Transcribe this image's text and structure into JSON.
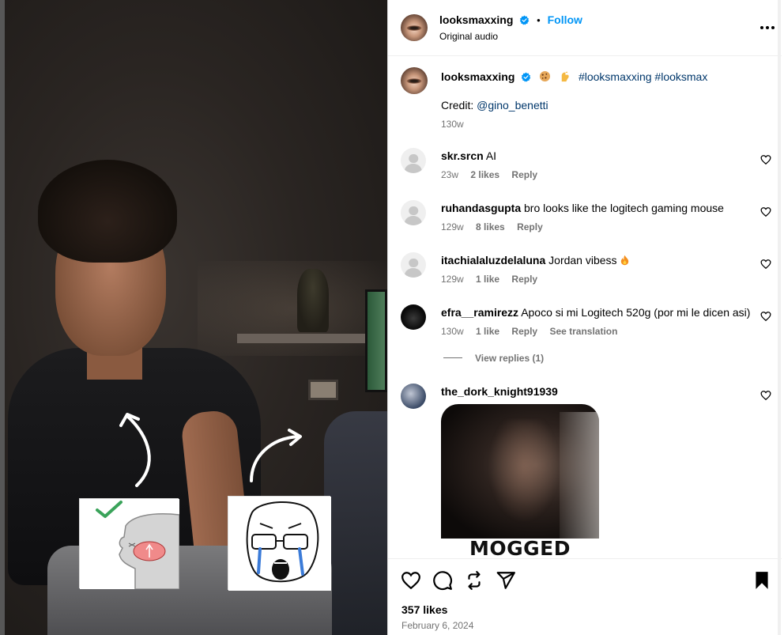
{
  "post": {
    "author": "looksmaxxing",
    "follow_label": "Follow",
    "dot": "•",
    "audio": "Original audio",
    "caption_hashtags": "#looksmaxxing #looksmax",
    "credit_label": "Credit:",
    "credit_handle": "@gino_benetti",
    "caption_age": "130w",
    "likes": "357 likes",
    "date": "February 6, 2024"
  },
  "media": {
    "sticker_text_1": "MOGGED"
  },
  "comments": [
    {
      "user": "skr.srcn",
      "text": "AI",
      "age": "23w",
      "likes": "2 likes",
      "reply": "Reply",
      "avatar": "default-avatar"
    },
    {
      "user": "ruhandasgupta",
      "text": "bro looks like the logitech gaming mouse",
      "age": "129w",
      "likes": "8 likes",
      "reply": "Reply",
      "avatar": "default-avatar"
    },
    {
      "user": "itachialaluzdelaluna",
      "text": "Jordan vibess",
      "age": "129w",
      "likes": "1 like",
      "reply": "Reply",
      "avatar": "default-avatar",
      "emoji": "fire-emoji"
    },
    {
      "user": "efra__ramirezz",
      "text": "Apoco si mi Logitech 520g (por mi le dicen asi)",
      "age": "130w",
      "likes": "1 like",
      "reply": "Reply",
      "translate": "See translation",
      "avatar": "dark-avatar"
    },
    {
      "user": "the_dork_knight91939",
      "text": "",
      "avatar": "photo-avatar"
    }
  ],
  "view_replies": "View replies (1)",
  "colors": {
    "accent_blue": "#0095f6",
    "hashtag_blue": "#00376b",
    "meta_gray": "#737373",
    "verified_blue": "#0095f6"
  },
  "icons": [
    "verified-badge-icon",
    "more-options-icon",
    "heart-icon",
    "comment-icon",
    "share-icon",
    "send-icon",
    "bookmark-icon",
    "fire-emoji",
    "cookie-emoji",
    "flexed-arm-emoji"
  ]
}
